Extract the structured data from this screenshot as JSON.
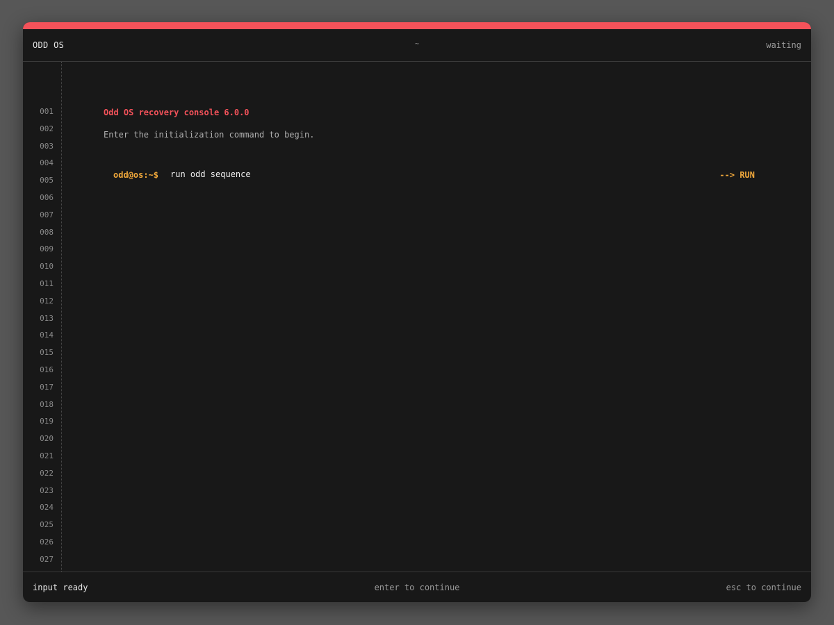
{
  "window": {
    "title": "ODD OS",
    "path": "~",
    "status": "waiting"
  },
  "gutter": {
    "line_numbers": [
      "001",
      "002",
      "003",
      "004",
      "005",
      "006",
      "007",
      "008",
      "009",
      "010",
      "011",
      "012",
      "013",
      "014",
      "015",
      "016",
      "017",
      "018",
      "019",
      "020",
      "021",
      "022",
      "023",
      "024",
      "025",
      "026",
      "027"
    ]
  },
  "console": {
    "banner": "Odd OS recovery console 6.0.0",
    "subtitle": "Enter the initialization command to begin.",
    "prompt": "odd@os:~$",
    "input_value": "run odd sequence",
    "run_label": "--> RUN"
  },
  "footer": {
    "left": "input ready",
    "center": "enter to continue",
    "right": "esc to continue"
  },
  "colors": {
    "accent": "#f4525a",
    "prompt": "#f2a93b",
    "background": "#181818"
  }
}
